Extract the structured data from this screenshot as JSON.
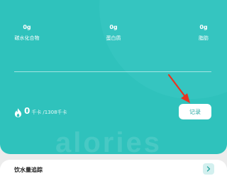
{
  "macros": [
    {
      "value": "0g",
      "label": "碳水化合物"
    },
    {
      "value": "0g",
      "label": "蛋白质"
    },
    {
      "value": "0g",
      "label": "脂肪"
    }
  ],
  "calories": {
    "value": "0",
    "unit": "千卡",
    "target": "/1308千卡",
    "icon": "flame-icon"
  },
  "record_button": {
    "label": "记录"
  },
  "watermark": "alories",
  "water_card": {
    "title": "饮水量追踪",
    "icon": "chevron-right-icon"
  },
  "colors": {
    "card_bg": "#2fc2bc",
    "button_text": "#2aa9a4",
    "arrow": "#e8341f",
    "page_bg": "#ececec"
  }
}
